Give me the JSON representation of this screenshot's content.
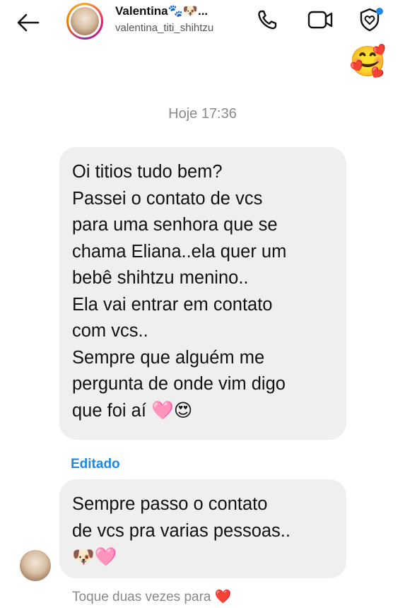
{
  "header": {
    "name": "Valentina🐾🐶...",
    "username": "valentina_titi_shihtzu",
    "icons": {
      "back": "arrow-left-icon",
      "call": "phone-icon",
      "video": "video-camera-icon",
      "shield": "shield-heart-icon"
    }
  },
  "floating_emoji": "🥰",
  "thread": {
    "timestamp": "Hoje 17:36",
    "messages": [
      {
        "lines": [
          "Oi titios tudo bem?",
          "Passei o contato de vcs",
          "para uma senhora que se",
          "chama Eliana..ela quer um",
          "bebê shihtzu menino..",
          "Ela vai entrar em contato",
          "com vcs..",
          "Sempre que alguém me",
          "pergunta de onde vim digo",
          "que foi aí 🩷😍"
        ]
      },
      {
        "edited_label": "Editado",
        "lines": [
          "Sempre passo o contato",
          "de vcs pra varias pessoas..",
          "🐶🩷"
        ]
      }
    ],
    "double_tap_hint": "Toque duas vezes para ❤️"
  },
  "colors": {
    "bubble": "#efefef",
    "edited": "#1e88e5",
    "muted": "#8a8a8a",
    "notification_dot": "#1e88e5"
  }
}
